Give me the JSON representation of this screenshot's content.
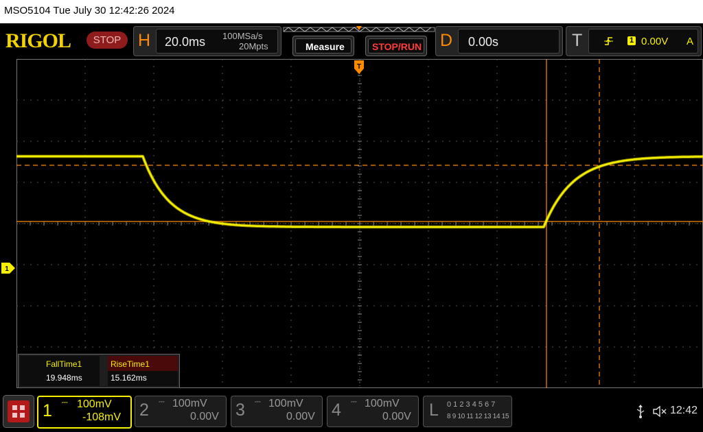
{
  "window_title": "MSO5104  Tue July 30 12:42:26 2024",
  "brand": "RIGOL",
  "run_state": "STOP",
  "horizontal": {
    "letter": "H",
    "timebase": "20.0ms",
    "sample_rate": "100MSa/s",
    "memory_depth": "20Mpts"
  },
  "buttons": {
    "measure": "Measure",
    "stop_run": "STOP/RUN"
  },
  "delay": {
    "letter": "D",
    "value": "0.00s"
  },
  "trigger": {
    "letter": "T",
    "channel": "1",
    "level": "0.00V",
    "mode": "A"
  },
  "measurements": [
    {
      "name": "FallTime1",
      "value": "19.948ms"
    },
    {
      "name": "RiseTime1",
      "value": "15.162ms"
    }
  ],
  "channels": [
    {
      "number": "1",
      "scale": "100mV",
      "offset": "-108mV",
      "active": true
    },
    {
      "number": "2",
      "scale": "100mV",
      "offset": "0.00V",
      "active": false
    },
    {
      "number": "3",
      "scale": "100mV",
      "offset": "0.00V",
      "active": false
    },
    {
      "number": "4",
      "scale": "100mV",
      "offset": "0.00V",
      "active": false
    }
  ],
  "logic": {
    "letter": "L",
    "row1": "0 1 2 3  4 5 6 7",
    "row2": "8 9 10 11 12 13 14 15"
  },
  "trigger_marker": "T",
  "ground_marker": "1",
  "clock": "12:42",
  "icons": {
    "menu": "menu-grid-icon",
    "usb": "usb-icon",
    "sound": "speaker-muted-icon",
    "trigger_edge": "rising-edge-icon"
  },
  "colors": {
    "ch1": "#f6f000",
    "accent": "#ff8a00",
    "stop": "#8e1c1c",
    "cursor": "#ff8a00"
  }
}
